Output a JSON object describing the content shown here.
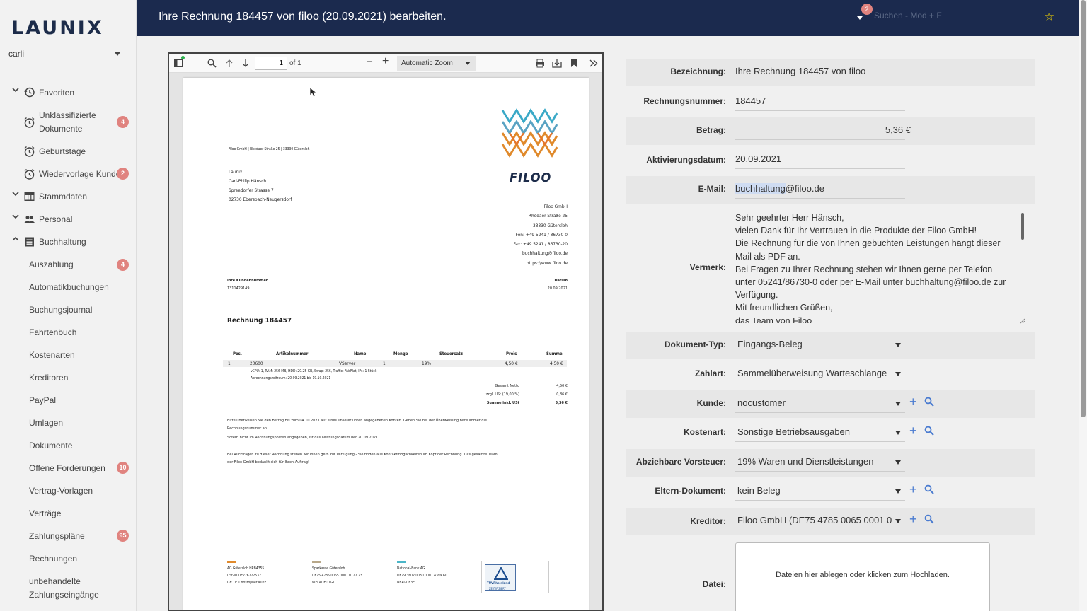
{
  "sidebar": {
    "logo": "LAUNIX",
    "user": "carli",
    "items": [
      {
        "label": "Favoriten",
        "chev": "⌄"
      },
      {
        "label": "Unklassifizierte",
        "label2": "Dokumente",
        "badge": "4"
      },
      {
        "label": "Geburtstage"
      },
      {
        "label": "Wiedervorlage Kunden",
        "badge": "2"
      },
      {
        "label": "Stammdaten",
        "chev": "⌄"
      },
      {
        "label": "Personal",
        "chev": "⌄"
      },
      {
        "label": "Buchhaltung",
        "chev": "⌃"
      },
      {
        "label": "Auszahlung",
        "badge": "4"
      },
      {
        "label": "Automatikbuchungen"
      },
      {
        "label": "Buchungsjournal"
      },
      {
        "label": "Fahrtenbuch"
      },
      {
        "label": "Kostenarten"
      },
      {
        "label": "Kreditoren"
      },
      {
        "label": "PayPal"
      },
      {
        "label": "Umlagen"
      },
      {
        "label": "Dokumente"
      },
      {
        "label": "Offene Forderungen",
        "badge": "10"
      },
      {
        "label": "Vertrag-Vorlagen"
      },
      {
        "label": "Verträge"
      },
      {
        "label": "Zahlungspläne",
        "badge": "95"
      },
      {
        "label": "Rechnungen"
      },
      {
        "label": "unbehandelte",
        "label2": "Zahlungseingänge"
      }
    ]
  },
  "header": {
    "title": "Ihre Rechnung 184457 von filoo (20.09.2021) bearbeiten.",
    "notification_count": "2",
    "search_placeholder": "Suchen - Mod + F"
  },
  "pdf_viewer": {
    "page_number": "1",
    "page_of": "of 1",
    "zoom": "Automatic Zoom"
  },
  "invoice": {
    "sender_line": "Filoo GmbH | Rhedaer Straße 25 | 33330 Gütersloh",
    "recipient": [
      "Launix",
      "Carl-Philip Hänsch",
      "Spreedorfer Strasse 7",
      "02730 Ebersbach-Neugersdorf"
    ],
    "logo_text": "FILOO",
    "company": [
      "Filoo GmbH",
      "Rhedaer Straße 25",
      "33330 Gütersloh",
      "Fon: +49 5241 / 86730-0",
      "Fax: +49 5241 / 86730-20",
      "buchhaltung@filoo.de",
      "https://www.filoo.de"
    ],
    "customer_no_label": "Ihre Kundennummer",
    "customer_no": "1311429149",
    "date_label": "Datum",
    "date": "20.09.2021",
    "title": "Rechnung 184457",
    "table_headers": [
      "Pos.",
      "Artikelnummer",
      "Name",
      "Menge",
      "Steuersatz",
      "Preis",
      "Summe"
    ],
    "row": [
      "1",
      "20600",
      "VServer",
      "1",
      "19%",
      "4,50 €",
      "4,50 €"
    ],
    "row_desc1": "vCPU: 1, RAM: 256 MB, HDD: 20.25 GB, Swap: 256, Traffic: FairFlat, IPs: 1 Stück",
    "row_desc2": "Abrechnungszeitraum: 20.09.2021 bis 19.10.2021",
    "totals": [
      {
        "label": "Gesamt Netto",
        "value": "4,50 €"
      },
      {
        "label": "zzgl. USt (19,00 %)",
        "value": "0,86 €"
      },
      {
        "label": "Summe inkl. USt",
        "value": "5,36 €"
      }
    ],
    "pay_note1": "Bitte überweisen Sie den Betrag bis zum 04.10.2021 auf eines unserer unten angegebenen Konten. Geben Sie bei der Überweisung bitte immer die",
    "pay_note2": "Rechnungsnummer an.",
    "pay_note3": "Sofern nicht im Rechnungsposten angegeben, ist das Leistungsdatum der 20.09.2021.",
    "contact_note1": "Bei Rückfragen zu dieser Rechnung stehen wir Ihnen gern zur Verfügung - Sie finden alle Kontaktmöglichkeiten im Kopf der Rechnung. Das gesamte Team",
    "contact_note2": "der Filoo GmbH bedankt sich für Ihren Auftrag!",
    "footer_col1": [
      "AG Gütersloh HRB4355",
      "USt-ID DE226772532",
      "GF: Dr. Christopher Kunz"
    ],
    "footer_col2": [
      "Sparkasse Gütersloh",
      "DE75 4785 0065 0001 0127 23",
      "WELADED1GTL"
    ],
    "footer_col3": [
      "National-Bank AG",
      "DE79 3602 0030 0001 4399 60",
      "NBAGDE3E"
    ],
    "tuv_label": "TÜVRheinland",
    "tuv_sub": "ZERTIFIZIERT",
    "colors": {
      "bar1": "#e08a2c",
      "bar2": "#b8a88a",
      "bar3": "#4bb6c8"
    }
  },
  "form": {
    "bezeichnung_label": "Bezeichnung:",
    "bezeichnung": "Ihre Rechnung 184457 von filoo",
    "rechnungsnummer_label": "Rechnungsnummer:",
    "rechnungsnummer": "184457",
    "betrag_label": "Betrag:",
    "betrag": "5,36 €",
    "aktivierungsdatum_label": "Aktivierungsdatum:",
    "aktivierungsdatum": "20.09.2021",
    "email_label": "E-Mail:",
    "email_selected": "buchhaltung",
    "email_rest": "@filoo.de",
    "vermerk_label": "Vermerk:",
    "vermerk_lines": [
      "Sehr geehrter Herr Hänsch,",
      "vielen Dank für Ihr Vertrauen in die Produkte der Filoo GmbH!",
      "Die Rechnung für die von Ihnen gebuchten Leistungen hängt dieser",
      "Mail als PDF an.",
      "Bei Fragen zu Ihrer Rechnung stehen wir Ihnen gerne per Telefon",
      "unter 05241/86730-0 oder per E-Mail unter buchhaltung@filoo.de zur",
      "Verfügung.",
      "Mit freundlichen Grüßen,",
      "das Team von Filoo"
    ],
    "dokumenttyp_label": "Dokument-Typ:",
    "dokumenttyp": "Eingangs-Beleg",
    "zahlart_label": "Zahlart:",
    "zahlart": "Sammelüberweisung Warteschlange",
    "kunde_label": "Kunde:",
    "kunde": "nocustomer",
    "kostenart_label": "Kostenart:",
    "kostenart": "Sonstige Betriebsausgaben",
    "vorsteuer_label": "Abziehbare Vorsteuer:",
    "vorsteuer": "19% Waren und Dienstleistungen",
    "eltern_label": "Eltern-Dokument:",
    "eltern": "kein Beleg",
    "kreditor_label": "Kreditor:",
    "kreditor": "Filoo GmbH (DE75 4785 0065 0001 0",
    "datei_label": "Datei:",
    "upload_text": "Dateien hier ablegen oder klicken zum Hochladen."
  }
}
